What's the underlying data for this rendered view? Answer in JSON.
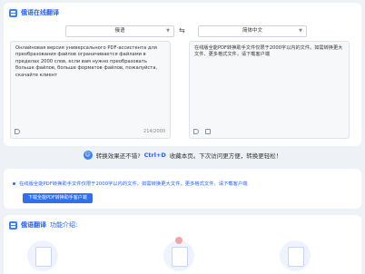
{
  "top": {
    "title": "俄语在线翻译",
    "source_lang": "俄语",
    "target_lang": "简体中文",
    "source_text": "Онлайновая версия универсального PDF-ассистента для преобразования файлов ограничивается файлами в пределах 2000 слов, если вам нужно преобразовать больше файлов, больше форматов файлов, пожалуйста, скачайте клиент",
    "target_text": "在线版全能PDF转换助手文件仅限于2000字以内的文件。如需转换更大文件、更多格式文件，请下载客户端",
    "char_count": "214/2000"
  },
  "feedback": {
    "prefix": "转换效果还不错?",
    "shortcut": "Ctrl+D",
    "suffix": "收藏本页。下次访问更方便，转换更轻松！",
    "smile": "☺"
  },
  "hint": {
    "text": "在线版全能PDF转换助手文件仅限于2000字以内的文件。如需转换更大文件、更多格式文件，请下载客户端",
    "button": "下载全能PDF转换助手客户端"
  },
  "features": {
    "title": "俄语翻译",
    "subtitle": "功能介绍:"
  },
  "icons": {
    "title": "translate-icon",
    "swap": "swap-icon",
    "speaker": "speaker-icon",
    "copy": "copy-icon"
  },
  "colors": {
    "accent": "#2563eb",
    "button": "#2f6ff0"
  }
}
